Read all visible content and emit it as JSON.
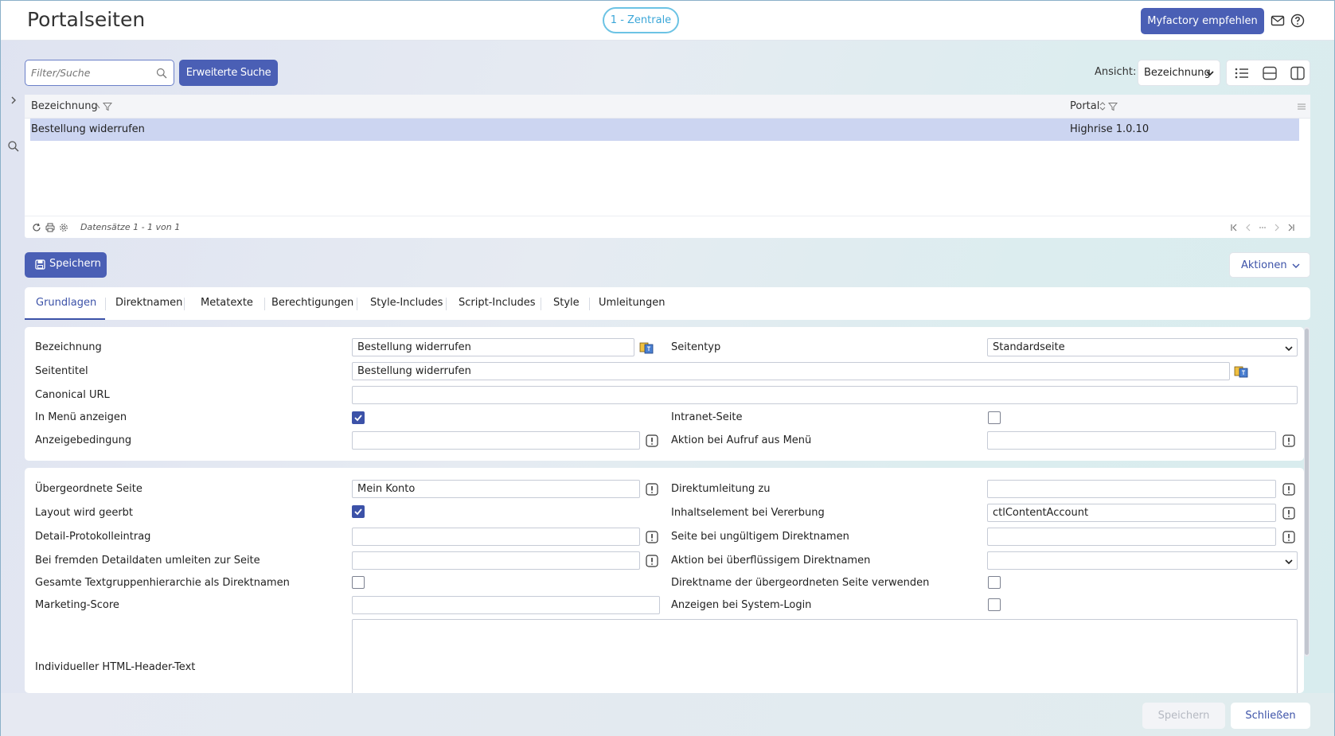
{
  "header": {
    "title": "Portalseiten",
    "client": "1 - Zentrale",
    "recommend": "Myfactory empfehlen",
    "mail_icon": "mail-icon",
    "help_icon": "help-icon"
  },
  "toolbar": {
    "search_placeholder": "Filter/Suche",
    "advanced_search": "Erweiterte Suche",
    "view_label": "Ansicht:",
    "view_value": "Bezeichnung"
  },
  "grid": {
    "columns": [
      "Bezeichnung",
      "Portal"
    ],
    "rows": [
      {
        "bezeichnung": "Bestellung widerrufen",
        "portal": "Highrise 1.0.10"
      }
    ],
    "footer": "Datensätze 1 - 1 von 1"
  },
  "actions": {
    "save": "Speichern",
    "actions": "Aktionen"
  },
  "tabs": [
    "Grundlagen",
    "Direktnamen",
    "Metatexte",
    "Berechtigungen",
    "Style-Includes",
    "Script-Includes",
    "Style",
    "Umleitungen"
  ],
  "form1": {
    "bezeichnung_label": "Bezeichnung",
    "bezeichnung_value": "Bestellung widerrufen",
    "seitentyp_label": "Seitentyp",
    "seitentyp_value": "Standardseite",
    "seitentitel_label": "Seitentitel",
    "seitentitel_value": "Bestellung widerrufen",
    "canonical_label": "Canonical URL",
    "canonical_value": "",
    "menu_label": "In Menü anzeigen",
    "menu_checked": true,
    "intranet_label": "Intranet-Seite",
    "intranet_checked": false,
    "anzeige_label": "Anzeigebedingung",
    "anzeige_value": "",
    "aktion_menu_label": "Aktion bei Aufruf aus Menü",
    "aktion_menu_value": ""
  },
  "form2": {
    "parent_label": "Übergeordnete Seite",
    "parent_value": "Mein Konto",
    "redirect_label": "Direktumleitung zu",
    "redirect_value": "",
    "layout_label": "Layout wird geerbt",
    "layout_checked": true,
    "content_label": "Inhaltselement bei Vererbung",
    "content_value": "ctlContentAccount",
    "log_label": "Detail-Protokolleintrag",
    "log_value": "",
    "invalid_label": "Seite bei ungültigem Direktnamen",
    "invalid_value": "",
    "foreign_label": "Bei fremden Detaildaten umleiten zur Seite",
    "foreign_value": "",
    "superfluous_label": "Aktion bei überflüssigem Direktnamen",
    "superfluous_value": "",
    "hierarchy_label": "Gesamte Textgruppenhierarchie als Direktnamen",
    "hierarchy_checked": false,
    "parent_direct_label": "Direktname der übergeordneten Seite verwenden",
    "parent_direct_checked": false,
    "marketing_label": "Marketing-Score",
    "marketing_value": "",
    "syslogin_label": "Anzeigen bei System-Login",
    "syslogin_checked": false,
    "html_header_label": "Individueller HTML-Header-Text"
  },
  "bottom": {
    "save": "Speichern",
    "close": "Schließen"
  },
  "colors": {
    "primary": "#4a5fb5",
    "accent": "#3c52a8",
    "selected_row": "#ccd5f1",
    "client_pill": "#3aa6d8"
  }
}
